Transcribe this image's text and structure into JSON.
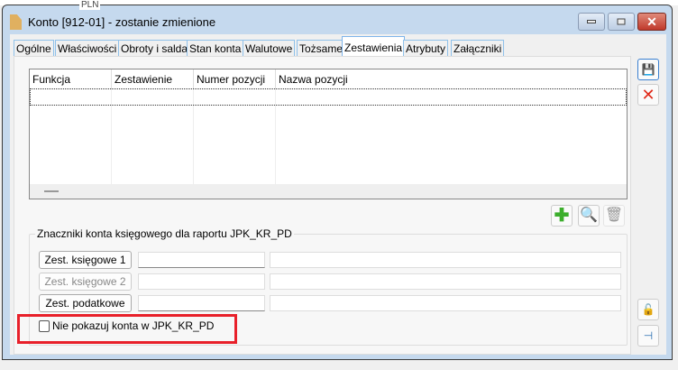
{
  "background": {
    "row_text": "PLN"
  },
  "window": {
    "title": "Konto [912-01] - zostanie zmienione",
    "close_glyph": "✕"
  },
  "tabs": [
    {
      "label": "Ogólne"
    },
    {
      "label": "Właściwości"
    },
    {
      "label": "Obroty i salda"
    },
    {
      "label": "Stan konta"
    },
    {
      "label": "Walutowe"
    },
    {
      "label": "Tożsame"
    },
    {
      "label": "Zestawienia"
    },
    {
      "label": "Atrybuty"
    },
    {
      "label": "Załączniki"
    }
  ],
  "active_tab": "Zestawienia",
  "grid": {
    "columns": [
      "Funkcja",
      "Zestawienie",
      "Numer pozycji",
      "Nazwa pozycji"
    ],
    "rows": []
  },
  "group": {
    "title": "Znaczniki konta księgowego dla raportu JPK_KR_PD",
    "rows": [
      {
        "button": "Zest. księgowe 1",
        "code": "",
        "name": "",
        "enabled": true
      },
      {
        "button": "Zest. księgowe 2",
        "code": "",
        "name": "",
        "enabled": false
      },
      {
        "button": "Zest. podatkowe",
        "code": "",
        "name": "",
        "enabled": true
      }
    ],
    "checkbox": {
      "label": "Nie pokazuj konta w JPK_KR_PD",
      "checked": false
    }
  },
  "colors": {
    "highlight": "#e8202a",
    "frame": "#c5d9ee",
    "tab_border": "#8fc1ea"
  }
}
